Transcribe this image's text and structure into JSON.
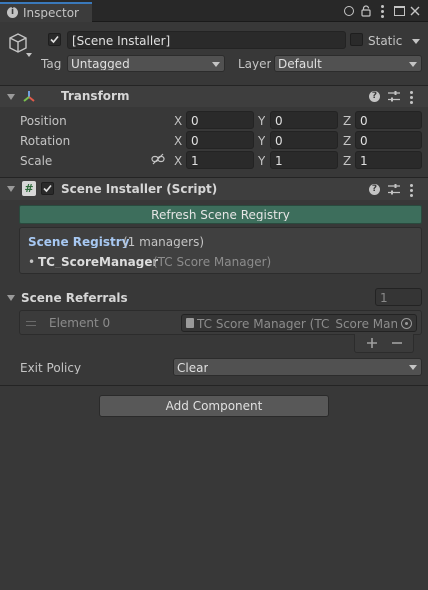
{
  "window": {
    "tab_title": "Inspector"
  },
  "object": {
    "name": "[Scene Installer]",
    "static_label": "Static",
    "tag_label": "Tag",
    "tag_value": "Untagged",
    "layer_label": "Layer",
    "layer_value": "Default"
  },
  "transform": {
    "title": "Transform",
    "rows": [
      {
        "label": "Position",
        "x": "0",
        "y": "0",
        "z": "0"
      },
      {
        "label": "Rotation",
        "x": "0",
        "y": "0",
        "z": "0"
      },
      {
        "label": "Scale",
        "x": "1",
        "y": "1",
        "z": "1"
      }
    ],
    "axis_x": "X",
    "axis_y": "Y",
    "axis_z": "Z"
  },
  "script": {
    "title": "Scene Installer (Script)",
    "hash_icon": "#",
    "refresh_button": "Refresh Scene Registry",
    "registry_title": "Scene Registry",
    "registry_count": "(1 managers)",
    "manager_bullet": "•",
    "manager_name": "TC_ScoreManager",
    "manager_desc": "(TC Score Manager)",
    "referrals_title": "Scene Referrals",
    "referrals_size": "1",
    "element_label": "Element 0",
    "element_value": "TC Score Manager (TC_Score Manager)",
    "exit_policy_label": "Exit Policy",
    "exit_policy_value": "Clear"
  },
  "footer": {
    "add_component": "Add Component"
  },
  "colors": {
    "accent": "#3a79bb",
    "refresh_button_bg": "#3d6e5c",
    "registry_title": "#a7c8f2",
    "background": "#383838"
  }
}
